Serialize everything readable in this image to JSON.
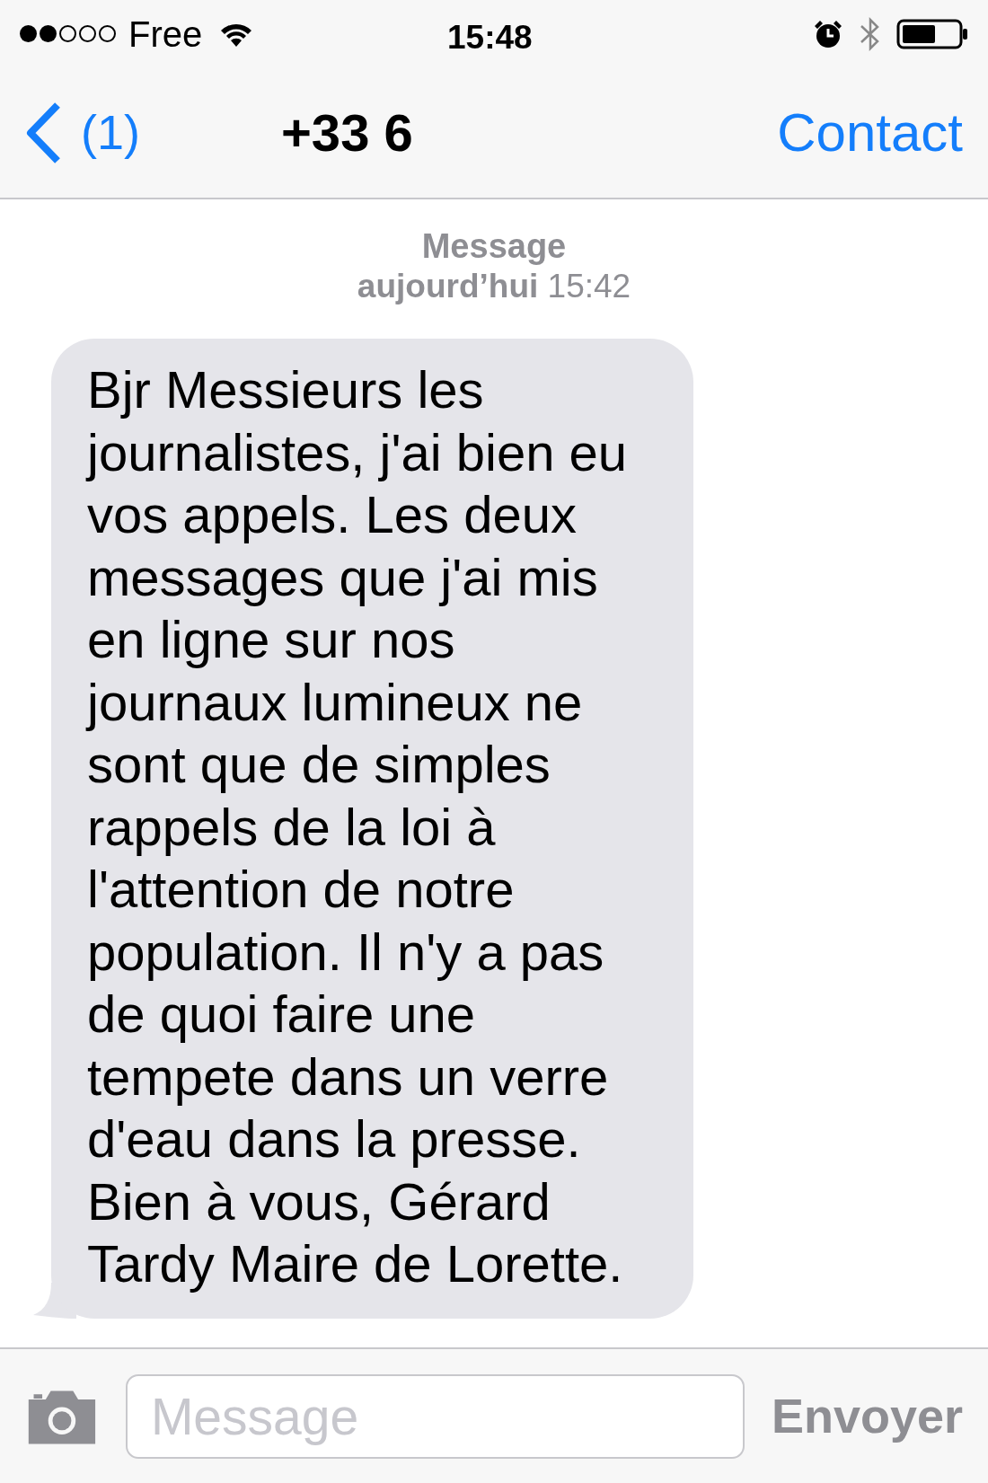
{
  "status_bar": {
    "carrier": "Free",
    "time": "15:48"
  },
  "nav_bar": {
    "back_label": "(1)",
    "title": "+33 6",
    "action": "Contact"
  },
  "conversation": {
    "header": "Message",
    "timestamp": "**aujourd’hui** 15:42",
    "messages": [
      {
        "kind": "received",
        "text": "Bjr Messieurs les\njournalistes, j'ai bien eu\nvos appels. Les deux\nmessages que j'ai mis\nen ligne sur nos\njournaux lumineux ne\nsont que de simples\nrappels de la loi à\nl'attention de notre\npopulation. Il n'y a pas\nde quoi faire une\ntempete dans un verre\nd'eau dans la presse.\nBien à vous, Gérard\nTardy Maire de Lorette."
      }
    ]
  },
  "composer": {
    "placeholder": "Message",
    "send": "Envoyer"
  }
}
